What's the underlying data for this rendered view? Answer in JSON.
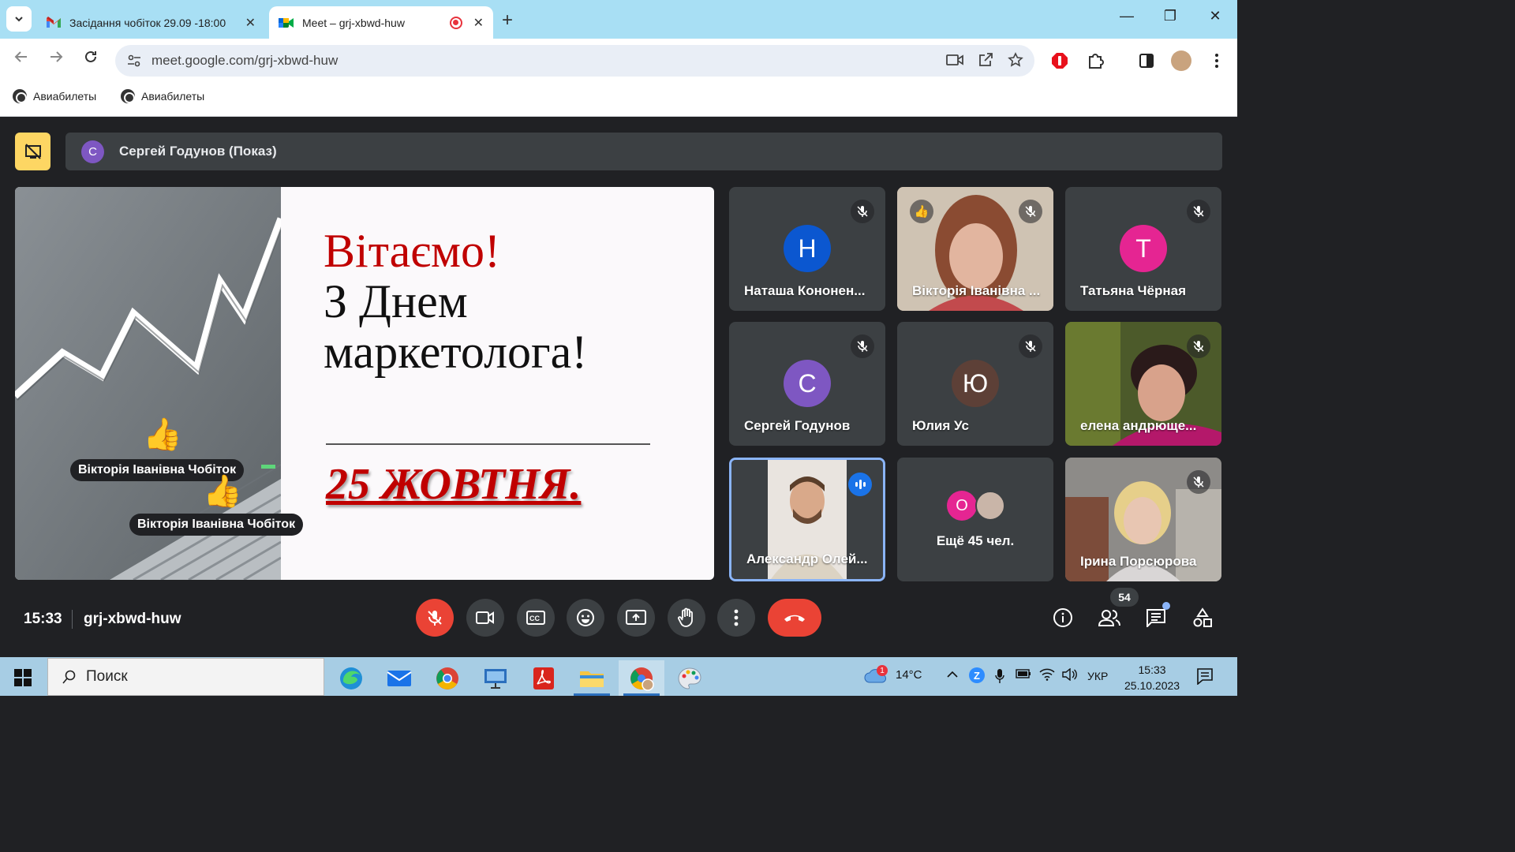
{
  "browser": {
    "tabs": [
      {
        "title": "Засідання чобіток 29.09 -18:00",
        "icon": "gmail-icon",
        "active": false
      },
      {
        "title": "Meet – grj-xbwd-huw",
        "icon": "google-meet-icon",
        "active": true
      }
    ],
    "url": "meet.google.com/grj-xbwd-huw",
    "bookmarks": [
      "Авиабилеты",
      "Авиабилеты"
    ]
  },
  "meet": {
    "presenter_label": "Сергей Годунов (Показ)",
    "presenter_initial": "С",
    "slide": {
      "title": "Вітаємо!",
      "subtitle_line1": "З Днем",
      "subtitle_line2": "маркетолога!",
      "date": "25 ЖОВТНЯ."
    },
    "reactions": [
      {
        "name": "Вікторія Іванівна Чобіток"
      },
      {
        "name": "Вікторія Іванівна Чобіток"
      }
    ],
    "participants": [
      {
        "name": "Наташа Кононен...",
        "initial": "Н",
        "color": "#0b57d0",
        "type": "avatar"
      },
      {
        "name": "Вікторія Іванівна ...",
        "type": "video"
      },
      {
        "name": "Татьяна Чёрная",
        "initial": "Т",
        "color": "#e52592",
        "type": "avatar"
      },
      {
        "name": "Сергей Годунов",
        "initial": "С",
        "color": "#7e57c2",
        "type": "avatar"
      },
      {
        "name": "Юлия Ус",
        "initial": "Ю",
        "color": "#5d4037",
        "type": "avatar"
      },
      {
        "name": "елена андрющe...",
        "type": "video"
      },
      {
        "name": "Александр Олей...",
        "type": "video"
      },
      {
        "name": "Ещё 45 чел.",
        "initial": "О",
        "color": "#e52592",
        "type": "more"
      },
      {
        "name": "Ірина Порсюрова",
        "type": "video"
      }
    ],
    "time": "15:33",
    "meeting_code": "grj-xbwd-huw",
    "participant_count": "54"
  },
  "taskbar": {
    "search_placeholder": "Поиск",
    "weather": "14°C",
    "weather_badge": "1",
    "language": "УКР",
    "time": "15:33",
    "date": "25.10.2023"
  }
}
